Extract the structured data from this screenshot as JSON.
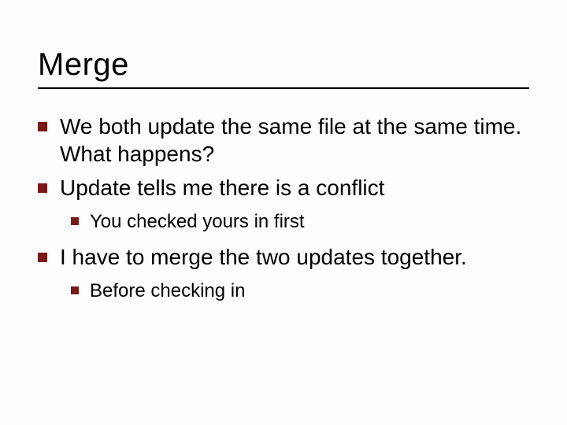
{
  "title": "Merge",
  "bullets": [
    {
      "text": "We both update the same file at the same time. What happens?",
      "children": []
    },
    {
      "text": "Update tells me there is a conflict",
      "children": [
        {
          "text": "You checked yours in first"
        }
      ]
    },
    {
      "text": "I have to merge the two updates together.",
      "children": [
        {
          "text": "Before checking in"
        }
      ]
    }
  ]
}
